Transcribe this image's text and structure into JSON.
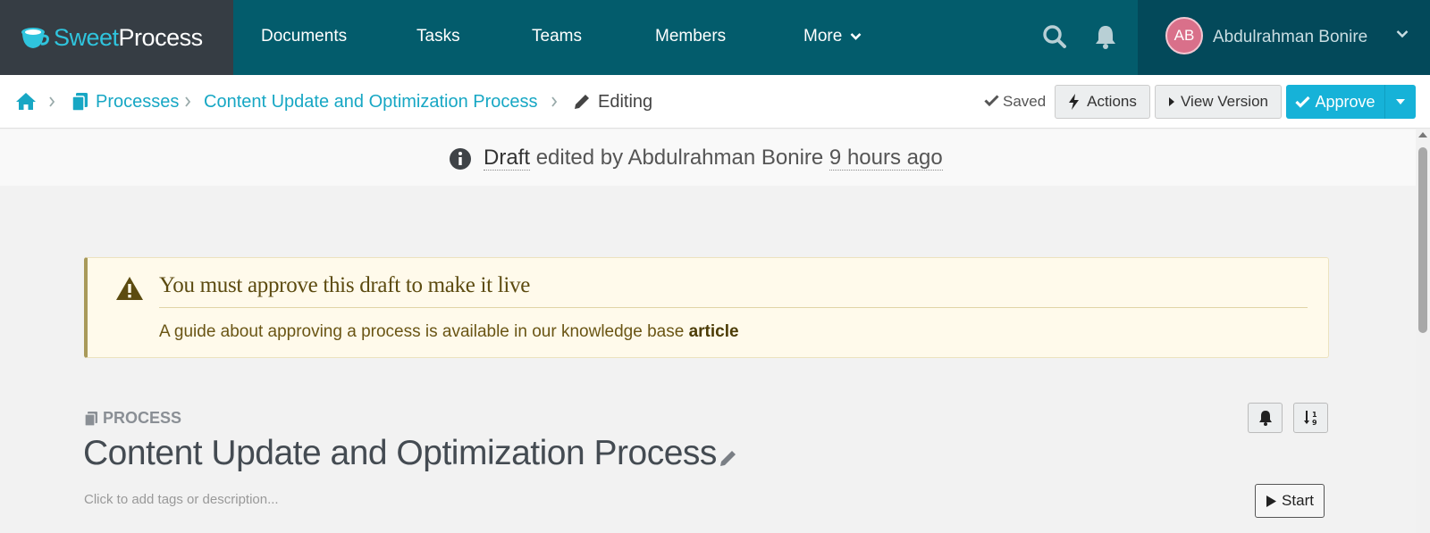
{
  "app": {
    "logo_part1": "Sweet",
    "logo_part2": "Process"
  },
  "nav": {
    "items": [
      {
        "label": "Documents"
      },
      {
        "label": "Tasks"
      },
      {
        "label": "Teams"
      },
      {
        "label": "Members"
      },
      {
        "label": "More"
      }
    ],
    "user": {
      "initials": "AB",
      "name": "Abdulrahman Bonire",
      "avatar_color": "#d9708a"
    }
  },
  "breadcrumb": {
    "processes": "Processes",
    "process_name": "Content Update and Optimization Process",
    "current": "Editing"
  },
  "toolbar": {
    "saved": "Saved",
    "actions": "Actions",
    "view_version": "View Version",
    "approve": "Approve"
  },
  "draft": {
    "status": "Draft",
    "edited_by": "edited by Abdulrahman Bonire",
    "time": "9 hours ago"
  },
  "alert": {
    "title": "You must approve this draft to make it live",
    "body": "A guide about approving a process is available in our knowledge base",
    "link": "article"
  },
  "process": {
    "label": "PROCESS",
    "title": "Content Update and Optimization Process",
    "description_placeholder": "Click to add tags or description...",
    "start": "Start"
  },
  "colors": {
    "nav_bg": "#035c6c",
    "accent": "#16b2d8",
    "logo_bg": "#363d44"
  }
}
